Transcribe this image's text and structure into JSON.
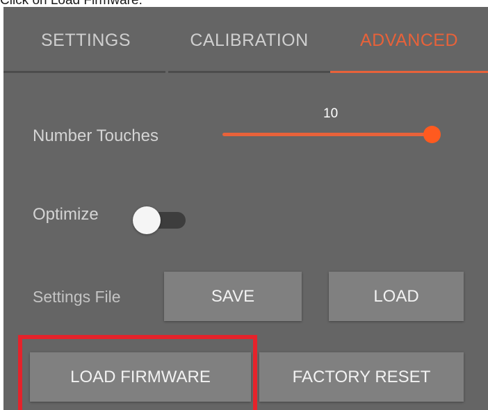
{
  "caption": "Click on Load Firmware.",
  "tabs": [
    {
      "label": "SETTINGS"
    },
    {
      "label": "CALIBRATION"
    },
    {
      "label": "ADVANCED"
    }
  ],
  "active_tab": "ADVANCED",
  "advanced": {
    "number_touches": {
      "label": "Number Touches",
      "value": "10",
      "fill_fraction": 1.0
    },
    "optimize": {
      "label": "Optimize",
      "state": "off"
    },
    "settings_file": {
      "label": "Settings File",
      "save_label": "SAVE",
      "load_label": "LOAD"
    },
    "load_firmware_label": "LOAD FIRMWARE",
    "factory_reset_label": "FACTORY RESET"
  },
  "colors": {
    "panel_bg": "#656565",
    "accent": "#e8623a",
    "highlight": "#e5232b",
    "button_bg": "#808080"
  }
}
